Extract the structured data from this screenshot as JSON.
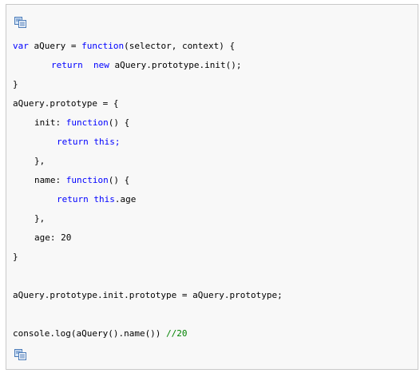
{
  "icons": {
    "copy_top": "copy-icon",
    "copy_bottom": "copy-icon"
  },
  "colors": {
    "keyword": "#0000ff",
    "comment": "#008200",
    "text": "#000000",
    "background": "#f8f8f8",
    "border": "#c9c9c9"
  },
  "code": {
    "l1_kw1": "var",
    "l1_t1": " aQuery = ",
    "l1_kw2": "function",
    "l1_t2": "(selector, context) {",
    "l2_kw1": "return",
    "l2_sp": "  ",
    "l2_kw2": "new",
    "l2_t1": " aQuery.prototype.init();",
    "l3": "}",
    "l4": "aQuery.prototype = {",
    "l5_t1": "init: ",
    "l5_kw1": "function",
    "l5_t2": "() {",
    "l6_kw1": "return",
    "l6_sp": " ",
    "l6_kw2": "this",
    "l6_t1": ";",
    "l7": "},",
    "l8_t1": "name: ",
    "l8_kw1": "function",
    "l8_t2": "() {",
    "l9_kw1": "return",
    "l9_sp": " ",
    "l9_kw2": "this",
    "l9_t1": ".age",
    "l10": "},",
    "l11": "age: 20",
    "l12": "}",
    "l13": "aQuery.prototype.init.prototype = aQuery.prototype;",
    "l14_t1": "console.log(aQuery().name()) ",
    "l14_cm": "//20"
  }
}
